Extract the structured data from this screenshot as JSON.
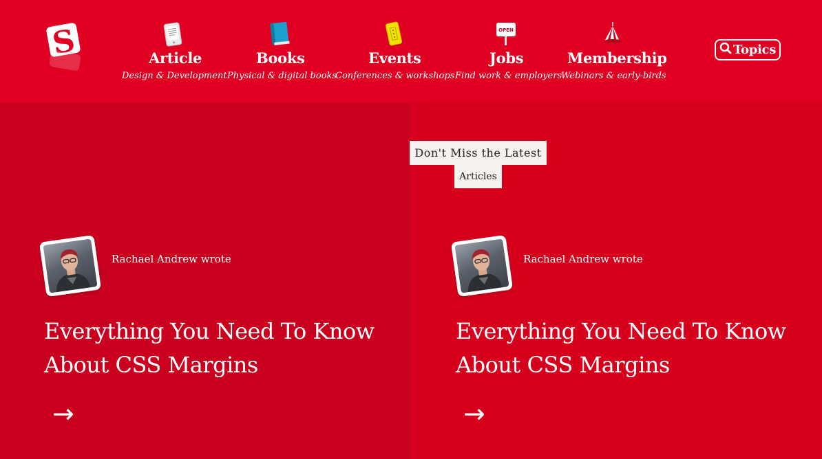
{
  "nav": {
    "items": [
      {
        "label": "Article",
        "sub": "Design & Development",
        "icon": "ebook-reader-icon"
      },
      {
        "label": "Books",
        "sub": "Physical & digital books",
        "icon": "book-icon"
      },
      {
        "label": "Events",
        "sub": "Conferences & workshops",
        "icon": "ticket-icon"
      },
      {
        "label": "Jobs",
        "sub": "Find work & employers",
        "icon": "open-sign-icon",
        "icon_text": "OPEN"
      },
      {
        "label": "Membership",
        "sub": "Webinars & early-birds",
        "icon": "circus-tent-icon"
      }
    ],
    "topics_label": "Topics"
  },
  "logo": {
    "letter": "S",
    "brand_color": "#e00022"
  },
  "tags": {
    "latest": "Don't Miss the Latest",
    "articles": "Articles"
  },
  "cards": [
    {
      "byline": "Rachael Andrew wrote",
      "title": "Everything You Need To Know About CSS Margins",
      "arrow": "→"
    },
    {
      "byline": "Rachael Andrew wrote",
      "title": "Everything You Need To Know About CSS Margins",
      "arrow": "→"
    }
  ],
  "colors": {
    "header_bg": "#e00022",
    "left_panel": "#c9001e",
    "right_panel": "#d6001c",
    "tag_bg": "#f6f2ef"
  }
}
